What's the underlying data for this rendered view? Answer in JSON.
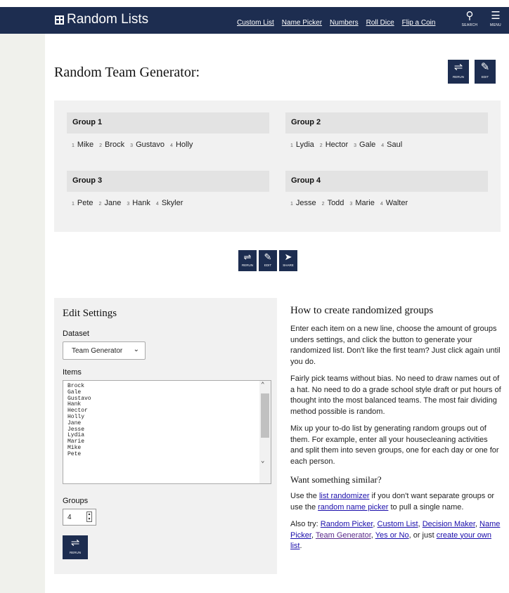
{
  "header": {
    "logo_text": "Random Lists",
    "nav": [
      "Custom List",
      "Name Picker",
      "Numbers",
      "Roll Dice",
      "Flip a Coin"
    ],
    "search_label": "SEARCH",
    "menu_label": "MENU"
  },
  "main": {
    "title": "Random Team Generator:",
    "rerun_label": "RERUN",
    "edit_label": "EDIT",
    "share_label": "SHARE"
  },
  "groups": [
    {
      "name": "Group 1",
      "members": [
        "Mike",
        "Brock",
        "Gustavo",
        "Holly"
      ]
    },
    {
      "name": "Group 2",
      "members": [
        "Lydia",
        "Hector",
        "Gale",
        "Saul"
      ]
    },
    {
      "name": "Group 3",
      "members": [
        "Pete",
        "Jane",
        "Hank",
        "Skyler"
      ]
    },
    {
      "name": "Group 4",
      "members": [
        "Jesse",
        "Todd",
        "Marie",
        "Walter"
      ]
    }
  ],
  "settings": {
    "heading": "Edit Settings",
    "dataset_label": "Dataset",
    "dataset_value": "Team Generator",
    "items_label": "Items",
    "items": [
      "Brock",
      "Gale",
      "Gustavo",
      "Hank",
      "Hector",
      "Holly",
      "Jane",
      "Jesse",
      "Lydia",
      "Marie",
      "Mike",
      "Pete"
    ],
    "groups_label": "Groups",
    "groups_value": "4",
    "rerun_label": "RERUN"
  },
  "howto": {
    "heading": "How to create randomized groups",
    "p1": "Enter each item on a new line, choose the amount of groups unders settings, and click the button to generate your randomized list. Don't like the first team? Just click again until you do.",
    "p2": "Fairly pick teams without bias. No need to draw names out of a hat. No need to do a grade school style draft or put hours of thought into the most balanced teams. The most fair dividing method possible is random.",
    "p3": "Mix up your to-do list by generating random groups out of them. For example, enter all your housecleaning activities and split them into seven groups, one for each day or one for each person.",
    "similar_heading": "Want something similar?",
    "sim_t1": "Use the ",
    "sim_link1": "list randomizer",
    "sim_t2": " if you don't want separate groups or use the ",
    "sim_link2": "random name picker",
    "sim_t3": " to pull a single name.",
    "also_prefix": "Also try: ",
    "also_links": [
      "Random Picker",
      "Custom List",
      "Decision Maker",
      "Name Picker",
      "Team Generator",
      "Yes or No"
    ],
    "also_mid": ", or just ",
    "also_last": "create your own list",
    "also_end": "."
  }
}
